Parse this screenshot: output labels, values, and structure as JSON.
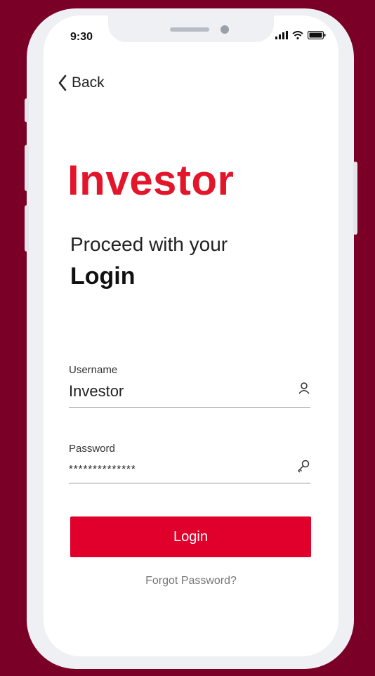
{
  "status_bar": {
    "time": "9:30",
    "icons": [
      "signal-icon",
      "wifi-icon",
      "battery-icon"
    ]
  },
  "nav": {
    "back_label": "Back",
    "back_icon": "chevron-left-icon"
  },
  "brand": {
    "name": "Investor",
    "color": "#e3152a"
  },
  "intro": {
    "subtitle": "Proceed with your",
    "heading": "Login"
  },
  "form": {
    "username": {
      "label": "Username",
      "value": "Investor",
      "icon": "user-icon"
    },
    "password": {
      "label": "Password",
      "value": "**************",
      "icon": "key-icon"
    },
    "submit_label": "Login",
    "forgot_label": "Forgot Password?"
  },
  "theme": {
    "background": "#7a0028",
    "accent": "#e0002b"
  }
}
